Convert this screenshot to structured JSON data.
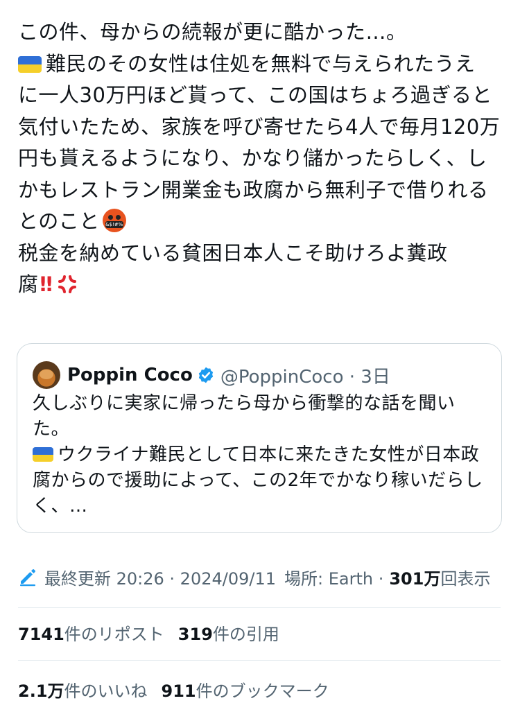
{
  "tweet": {
    "lines": [
      "この件、母からの続報が更に酷かった…。",
      "難民のその女性は住処を無料で与えられたうえ",
      "に一人30万円ほど貰って、この国はちょろ過ぎると",
      "気付いたため、家族を呼び寄せたら4人で毎月120万",
      "円も貰えるようになり、かなり儲かったらしく、し",
      "かもレストラン開業金も政腐から無利子で借りれる",
      "とのこと",
      "税金を納めている貧困日本人こそ助けろよ糞政",
      "腐"
    ],
    "exclamation": "‼",
    "flag_icon": "ukraine-flag-icon",
    "angry_icon": "face-with-symbols-icon",
    "angry_symbols": "&$!#%",
    "anger_icon": "anger-symbol-icon"
  },
  "quote": {
    "name": "Poppin Coco",
    "handle_time": "@PoppinCoco · 3日",
    "lines": [
      "久しぶりに実家に帰ったら母から衝撃的な話を聞い",
      "た。",
      "ウクライナ難民として日本に来たきた女性が日本政",
      "腐からので援助によって、この2年でかなり稼いだらし",
      "く、…"
    ],
    "verified_icon": "verified-badge-icon"
  },
  "meta": {
    "edited": "最終更新 20:26 · 2024/09/11",
    "location": "場所: Earth ·",
    "views_num": "301万",
    "views_label": "回表示",
    "edit_icon": "pencil-icon"
  },
  "stats": {
    "reposts_num": "7141",
    "reposts_label": "件のリポスト",
    "quotes_num": "319",
    "quotes_label": "件の引用",
    "likes_num": "2.1万",
    "likes_label": "件のいいね",
    "bookmarks_num": "911",
    "bookmarks_label": "件のブックマーク"
  },
  "colors": {
    "text": "#0f1419",
    "secondary": "#536471",
    "accent": "#1d9bf0",
    "border": "#cfd9de",
    "alert_red": "#e0242e",
    "flag_blue": "#2f6fd6",
    "flag_yellow": "#f5cf2a"
  }
}
